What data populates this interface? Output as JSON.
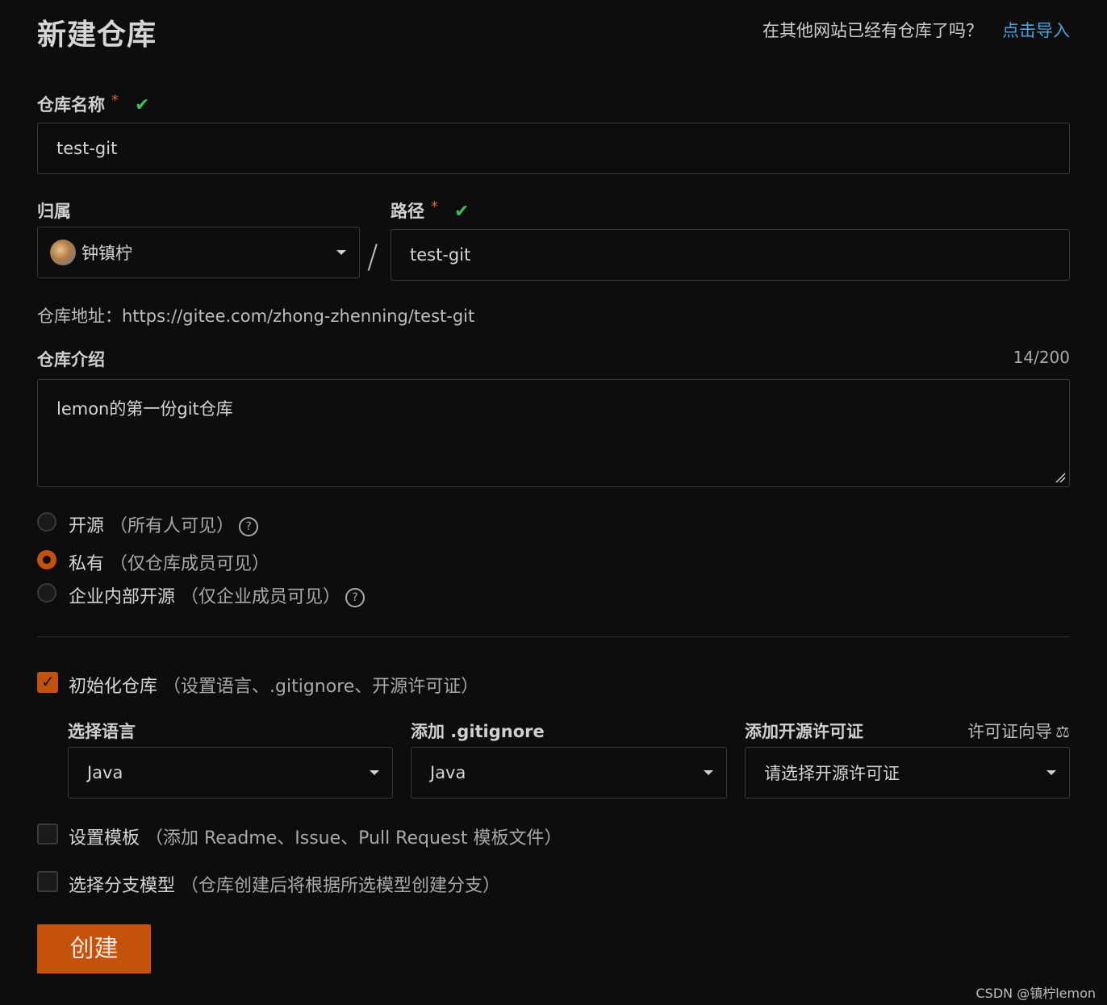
{
  "header": {
    "title": "新建仓库",
    "import_question": "在其他网站已经有仓库了吗？",
    "import_link": "点击导入"
  },
  "repo_name": {
    "label": "仓库名称",
    "required": "*",
    "valid_icon": "check-icon",
    "value": "test-git"
  },
  "owner": {
    "label": "归属",
    "value": "钟镇柠",
    "avatar": "avatar"
  },
  "separator": "/",
  "path": {
    "label": "路径",
    "required": "*",
    "value": "test-git"
  },
  "address": {
    "text": "仓库地址：https://gitee.com/zhong-zhenning/test-git"
  },
  "description": {
    "label": "仓库介绍",
    "counter": "14/200",
    "value": "lemon的第一份git仓库"
  },
  "visibility": {
    "options": [
      {
        "label": "开源",
        "sub": "（所有人可见）",
        "help": "?",
        "selected": false
      },
      {
        "label": "私有",
        "sub": "（仅仓库成员可见）",
        "help": "",
        "selected": true
      },
      {
        "label": "企业内部开源",
        "sub": "（仅企业成员可见）",
        "help": "?",
        "selected": false
      }
    ]
  },
  "init": {
    "checked": true,
    "label": "初始化仓库",
    "sub": "（设置语言、.gitignore、开源许可证）",
    "language": {
      "label": "选择语言",
      "value": "Java"
    },
    "gitignore": {
      "label": "添加 .gitignore",
      "value": "Java"
    },
    "license": {
      "label": "添加开源许可证",
      "guide": "许可证向导",
      "guide_icon": "scale-icon",
      "value": "请选择开源许可证"
    }
  },
  "template": {
    "checked": false,
    "label": "设置模板",
    "sub": "（添加 Readme、Issue、Pull Request 模板文件）"
  },
  "branch_model": {
    "checked": false,
    "label": "选择分支模型",
    "sub": "（仓库创建后将根据所选模型创建分支）"
  },
  "create_button": "创建",
  "watermark": "CSDN @镇柠lemon",
  "colors": {
    "accent": "#c4520d",
    "link": "#4aa3df",
    "valid": "#3fbf5a",
    "background": "#0d0d0d"
  }
}
